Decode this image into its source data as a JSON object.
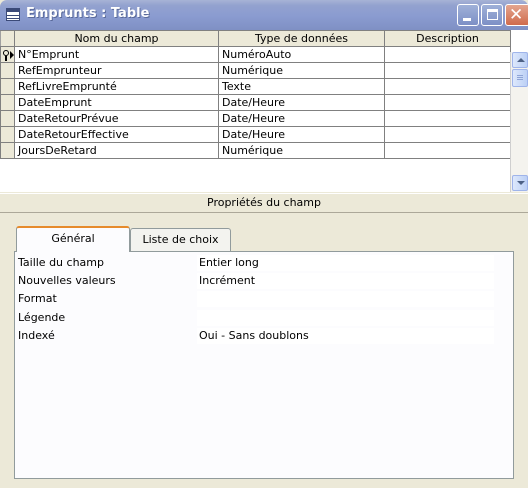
{
  "window": {
    "title": "Emprunts : Table",
    "icon": "table-icon",
    "controls": [
      "minimize-icon",
      "maximize-icon",
      "close-icon"
    ]
  },
  "grid": {
    "columns": [
      "Nom du champ",
      "Type de données",
      "Description"
    ],
    "rows": [
      {
        "name": "N°Emprunt",
        "type": "NuméroAuto",
        "description": "",
        "primary_key": true,
        "current": true
      },
      {
        "name": "RefEmprunteur",
        "type": "Numérique",
        "description": ""
      },
      {
        "name": "RefLivreEmprunté",
        "type": "Texte",
        "description": ""
      },
      {
        "name": "DateEmprunt",
        "type": "Date/Heure",
        "description": ""
      },
      {
        "name": "DateRetourPrévue",
        "type": "Date/Heure",
        "description": ""
      },
      {
        "name": "DateRetourEffective",
        "type": "Date/Heure",
        "description": ""
      },
      {
        "name": "JoursDeRetard",
        "type": "Numérique",
        "description": ""
      }
    ]
  },
  "properties": {
    "header": "Propriétés du champ",
    "tabs": [
      "Général",
      "Liste de choix"
    ],
    "active_tab": "Général",
    "items": [
      {
        "label": "Taille du champ",
        "value": "Entier long"
      },
      {
        "label": "Nouvelles valeurs",
        "value": "Incrément"
      },
      {
        "label": "Format",
        "value": ""
      },
      {
        "label": "Légende",
        "value": ""
      },
      {
        "label": "Indexé",
        "value": "Oui - Sans doublons"
      }
    ]
  },
  "colors": {
    "titlebar": "#8a9bd0",
    "chrome": "#ece9d8",
    "active_tab_accent": "#e68b2c"
  }
}
